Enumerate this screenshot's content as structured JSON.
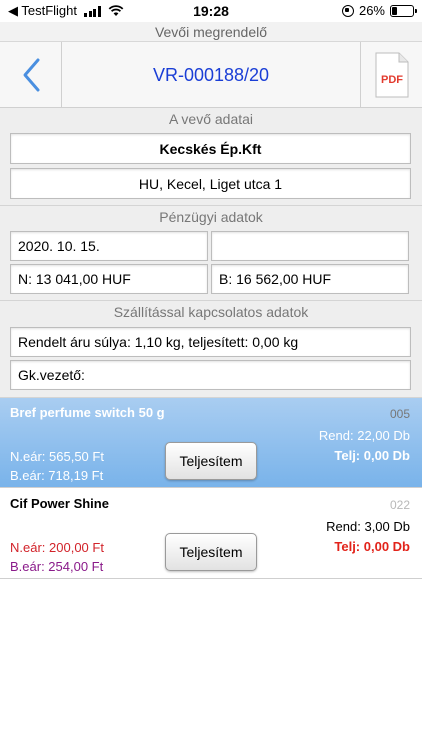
{
  "status_bar": {
    "back_app": "◀ TestFlight",
    "time": "19:28",
    "battery": "26%",
    "battery_level": 0.26
  },
  "header": {
    "title": "Vevői megrendelő",
    "order_number": "VR-000188/20",
    "pdf_label": "PDF"
  },
  "customer": {
    "title": "A vevő adatai",
    "name": "Kecskés Ép.Kft",
    "address": "HU, Kecel, Liget utca 1"
  },
  "financial": {
    "title": "Pénzügyi adatok",
    "date": "2020. 10. 15.",
    "empty_value": "",
    "net": "N: 13 041,00 HUF",
    "gross": "B: 16 562,00 HUF"
  },
  "shipping": {
    "title": "Szállítással kapcsolatos adatok",
    "weight": "Rendelt áru súlya:  1,10 kg, teljesített: 0,00 kg",
    "driver": "Gk.vezető:"
  },
  "items": [
    {
      "name": "Bref perfume switch 50 g",
      "code": "005",
      "ordered": "Rend: 22,00 Db",
      "fulfilled": "Telj: 0,00 Db",
      "net_price": "N.eár: 565,50 Ft",
      "gross_price": "B.eár: 718,19 Ft",
      "button": "Teljesítem"
    },
    {
      "name": "Cif Power Shine",
      "code": "022",
      "ordered": "Rend: 3,00 Db",
      "fulfilled": "Telj: 0,00 Db",
      "net_price": "N.eár: 200,00 Ft",
      "gross_price": "B.eár: 254,00 Ft",
      "button": "Teljesítem"
    }
  ],
  "colors": {
    "accent": "#1a3ed6",
    "selected_row": "#79b3ea",
    "fulfilled_red": "#e2231a",
    "gross_price_purple": "#8a1a8a",
    "pdf_red": "#e23b2e"
  },
  "icons": {
    "back": "chevron-left-icon",
    "pdf": "pdf-document-icon"
  }
}
